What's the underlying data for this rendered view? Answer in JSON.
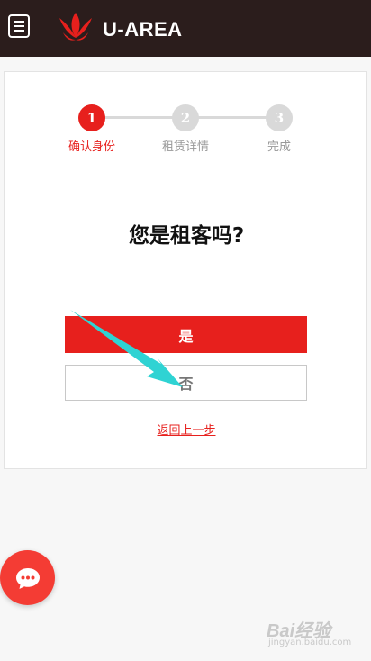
{
  "header": {
    "logo_text": "U-AREA",
    "menu_icon": "hamburger-icon",
    "logo_icon": "lotus-logo-icon",
    "background_color": "#2b1d1c"
  },
  "stepper": {
    "steps": [
      {
        "number": "1",
        "label": "确认身份",
        "active": true
      },
      {
        "number": "2",
        "label": "租赁详情",
        "active": false
      },
      {
        "number": "3",
        "label": "完成",
        "active": false
      }
    ],
    "active_color": "#e7201d",
    "inactive_color": "#d9d9d9"
  },
  "question": "您是租客吗?",
  "buttons": {
    "yes_label": "是",
    "no_label": "否"
  },
  "back_link": "返回上一步",
  "chat": {
    "icon": "chat-bubble-icon",
    "color": "#f43c34"
  },
  "watermark": {
    "main": "Bai经验",
    "sub": "jingyan.baidu.com"
  },
  "annotation": {
    "icon": "arrow-pointer-icon",
    "color": "#2fd3d3"
  }
}
